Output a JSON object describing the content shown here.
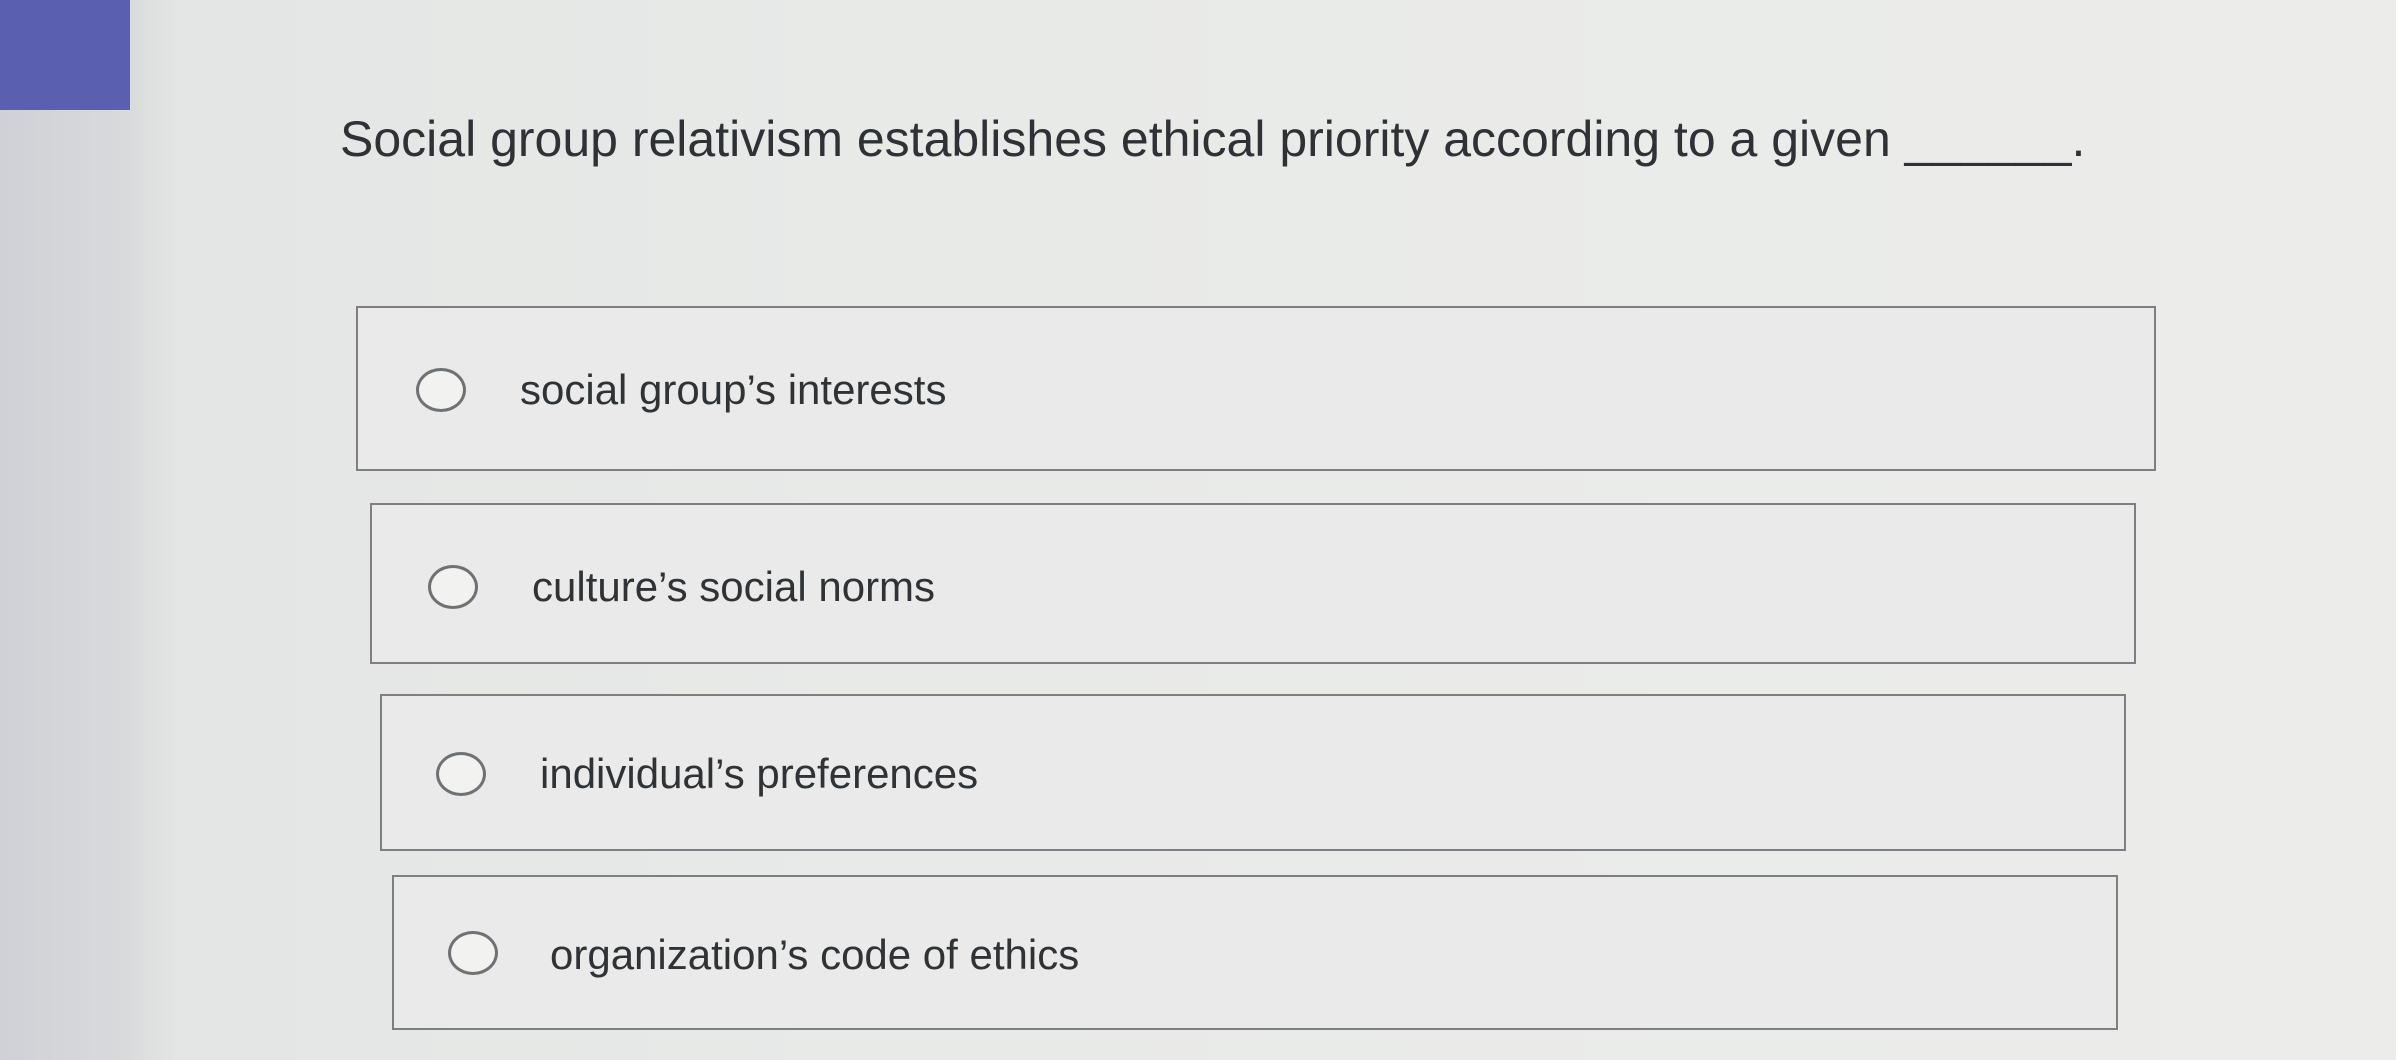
{
  "question": {
    "text": "Social group relativism establishes ethical priority according to a given ______."
  },
  "options": [
    {
      "label": "social group’s interests"
    },
    {
      "label": "culture’s social norms"
    },
    {
      "label": "individual’s preferences"
    },
    {
      "label": "organization’s code of ethics"
    }
  ],
  "colors": {
    "accent": "#5a5fae",
    "background": "#e8eae8",
    "border": "#7d7f80",
    "text": "#2f3336"
  }
}
